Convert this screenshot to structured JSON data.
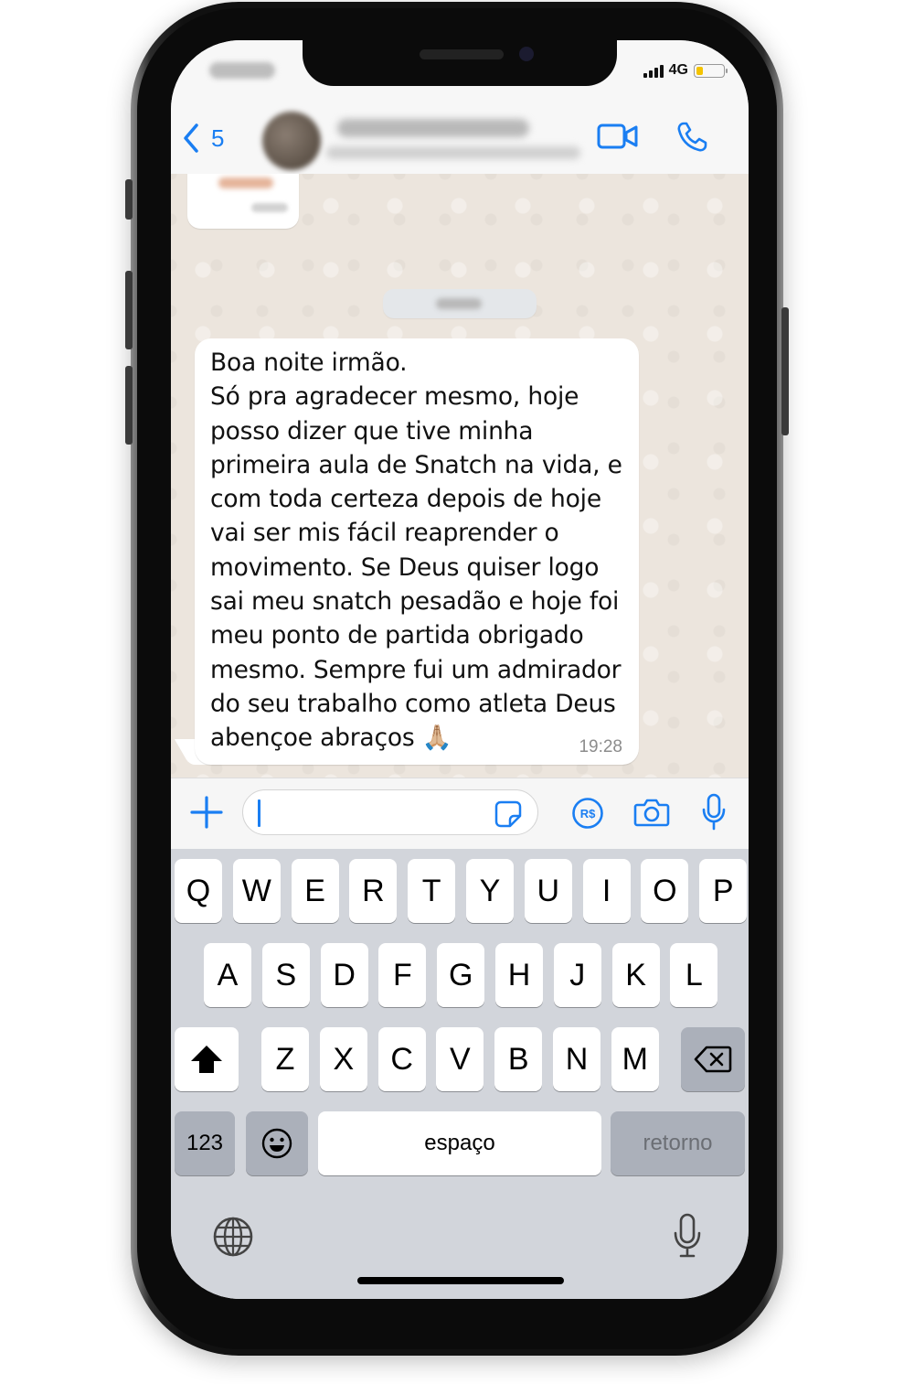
{
  "status": {
    "network": "4G"
  },
  "header": {
    "back_count": "5"
  },
  "message": {
    "text": "Boa noite irmão.\nSó pra agradecer mesmo, hoje posso dizer que tive minha primeira aula de Snatch na vida, e com toda certeza depois de hoje vai ser mis fácil reaprender o movimento. Se Deus quiser logo sai meu snatch pesadão e hoje foi meu ponto de partida obrigado mesmo. Sempre fui um admirador do seu trabalho como atleta Deus abençoe abraços 🙏🏼",
    "time": "19:28"
  },
  "keyboard": {
    "row1": [
      "Q",
      "W",
      "E",
      "R",
      "T",
      "Y",
      "U",
      "I",
      "O",
      "P"
    ],
    "row2": [
      "A",
      "S",
      "D",
      "F",
      "G",
      "H",
      "J",
      "K",
      "L"
    ],
    "row3": [
      "Z",
      "X",
      "C",
      "V",
      "B",
      "N",
      "M"
    ],
    "numbers_label": "123",
    "space_label": "espaço",
    "return_label": "retorno"
  },
  "icons": [
    "back-chevron-icon",
    "video-call-icon",
    "phone-call-icon",
    "plus-icon",
    "sticker-icon",
    "payment-icon",
    "camera-icon",
    "microphone-icon",
    "shift-icon",
    "backspace-icon",
    "emoji-icon",
    "globe-icon",
    "dictation-icon"
  ],
  "colors": {
    "accent": "#1a7ef2",
    "chat_bg": "#ece5dd",
    "battery": "#f4c300",
    "keyboard_bg": "#d2d5db"
  }
}
